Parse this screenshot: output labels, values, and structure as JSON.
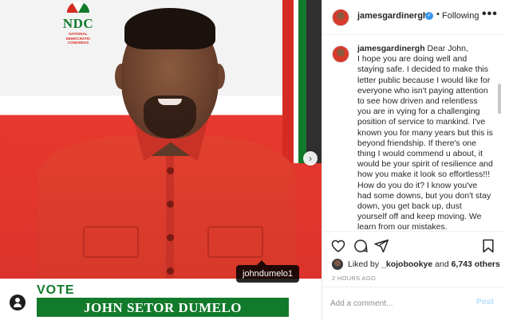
{
  "post": {
    "username": "jamesgardinergh",
    "follow_status": "Following",
    "separator": "•",
    "more_label": "•••"
  },
  "poster": {
    "party_abbr": "NDC",
    "party_name": "NATIONAL DEMOCRATIC CONGRESS",
    "vote_label": "VOTE",
    "candidate_name": "JOHN SETOR DUMELO",
    "tag": "johndumelo1",
    "next_arrow": "›"
  },
  "caption": {
    "username": "jamesgardinergh",
    "text": "Dear John,\nI hope you are doing well and staying safe. I decided to make this letter public because I would like for everyone who isn't paying attention to see how driven and relentless you are in vying for a challenging position of service to mankind. I've known you for many years but this is beyond friendship. If there's one thing I would commend u about, it would be your spirit of resilience and how you make it look so effortless!!! How do you do it? I know you've had some downs, but you don't stay down, you get back up, dust yourself off and keep moving. We learn from our mistakes.\nKofi, I'm sure a lot of people would"
  },
  "likes": {
    "prefix": "Liked by ",
    "user": "_kojobookye",
    "middle": " and ",
    "count": "6,743 others"
  },
  "timestamp": "2 HOURS AGO",
  "comment_box": {
    "placeholder": "Add a comment...",
    "post_label": "Post"
  },
  "icons": {
    "heart": "heart-icon",
    "comment": "comment-icon",
    "share": "share-icon",
    "save": "bookmark-icon",
    "verified": "verified-badge-icon",
    "tag": "user-tag-icon",
    "more": "more-options-icon"
  },
  "colors": {
    "ndc_green": "#127a2b",
    "ndc_red": "#d62b22",
    "verified_blue": "#3897f0",
    "post_button": "#b2dffc"
  }
}
